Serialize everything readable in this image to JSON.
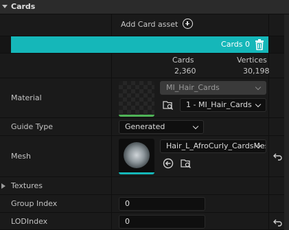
{
  "section": {
    "title": "Cards"
  },
  "add_card": {
    "label": "Add Card asset"
  },
  "cards_bar": {
    "label": "Cards 0"
  },
  "stats": {
    "cards_header": "Cards",
    "cards_value": "2,360",
    "vertices_header": "Vertices",
    "vertices_value": "30,198"
  },
  "material": {
    "label": "Material",
    "asset": "MI_Hair_Cards",
    "slot": "1 - MI_Hair_Cards"
  },
  "guide_type": {
    "label": "Guide Type",
    "value": "Generated"
  },
  "mesh": {
    "label": "Mesh",
    "asset": "Hair_L_AfroCurly_CardsMesh"
  },
  "textures": {
    "label": "Textures"
  },
  "group_index": {
    "label": "Group Index",
    "value": "0"
  },
  "lod_index": {
    "label": "LODIndex",
    "value": "0"
  },
  "colors": {
    "accent": "#15b7b9",
    "material_underline": "#4fb457"
  },
  "icons": [
    "plus-circle-icon",
    "trash-icon",
    "browse-icon",
    "use-selected-icon",
    "reset-arrow-icon",
    "collapse-triangle-icon"
  ]
}
